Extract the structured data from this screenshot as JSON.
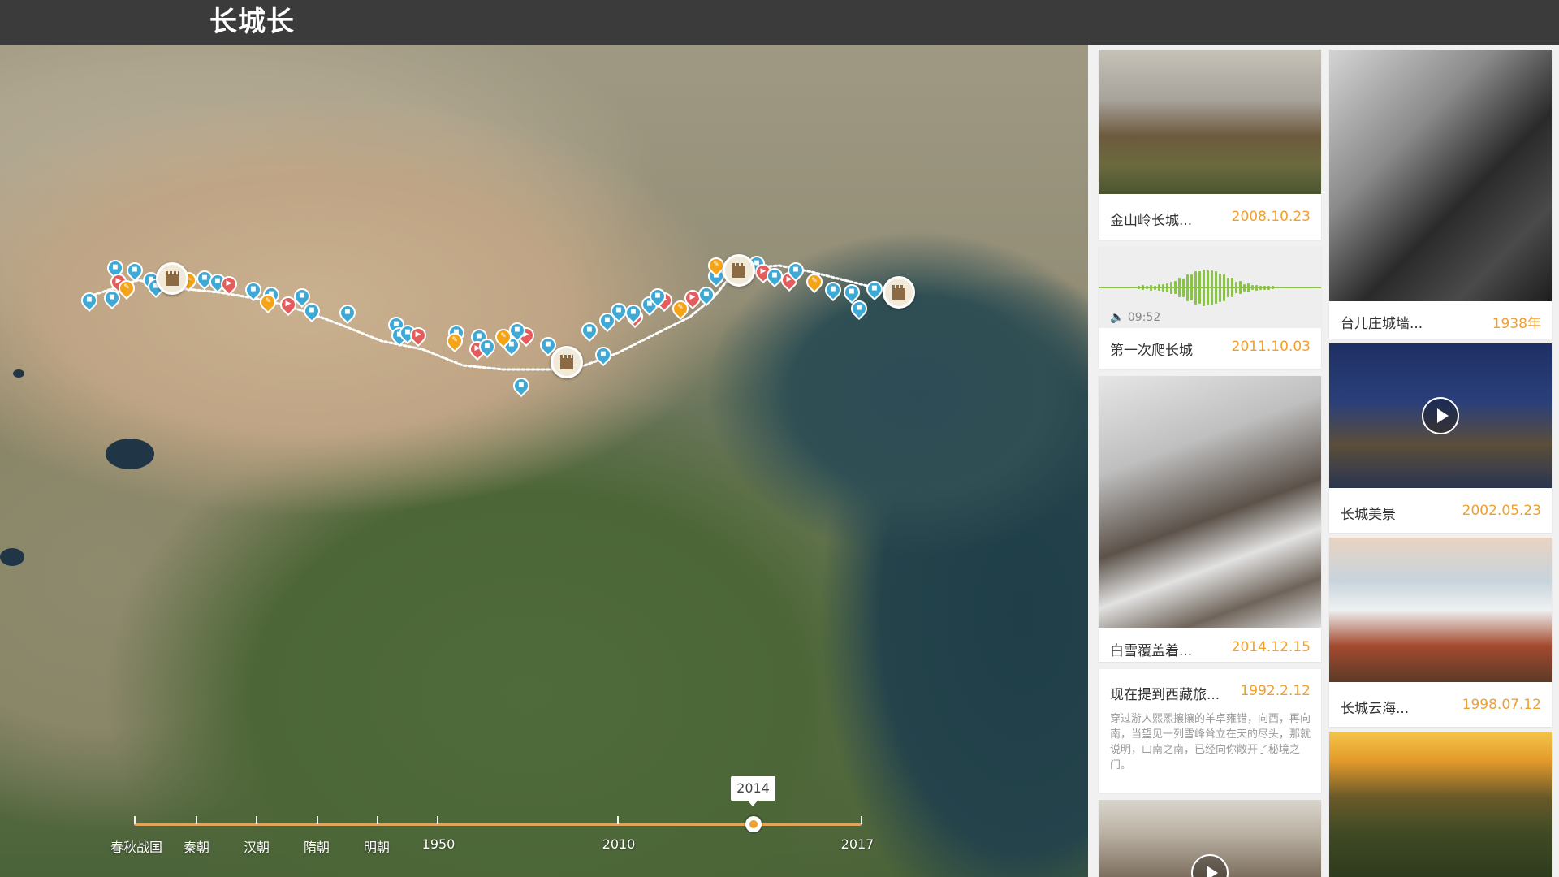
{
  "app": {
    "title": "长城长"
  },
  "colors": {
    "accent": "#f0a031",
    "photo_pin": "#3fa9d6",
    "video_pin": "#e45c5c",
    "key_pin": "#f5a417",
    "header_bg": "#3b3b3b",
    "wave": "#8bc34a"
  },
  "map": {
    "pin_types": {
      "photo": "camera-icon",
      "video": "video-camera-icon",
      "key": "key-icon",
      "fort": "great-wall-fort-icon"
    }
  },
  "timeline": {
    "labels": [
      "春秋战国",
      "秦朝",
      "汉朝",
      "隋朝",
      "明朝",
      "1950",
      "2010",
      "2017"
    ],
    "selected": "2014"
  },
  "feed": {
    "cards": [
      {
        "caption": "金山岭长城...",
        "date": "2008.10.23",
        "type": "photo"
      },
      {
        "caption": "第一次爬长城",
        "date": "2011.10.03",
        "type": "audio",
        "duration": "09:52"
      },
      {
        "caption": "白雪覆盖着...",
        "date": "2014.12.15",
        "type": "photo"
      },
      {
        "caption": "现在提到西藏旅...",
        "date": "1992.2.12",
        "type": "story",
        "excerpt": "穿过游人熙熙攘攘的羊卓雍错，向西，再向南，当望见一列雪峰耸立在天的尽头，那就说明，山南之南，已经向你敞开了秘境之门。"
      },
      {
        "caption": "台儿庄城墙...",
        "date": "1938年",
        "type": "photo"
      },
      {
        "caption": "长城美景",
        "date": "2002.05.23",
        "type": "video"
      },
      {
        "caption": "长城云海...",
        "date": "1998.07.12",
        "type": "photo"
      }
    ]
  }
}
